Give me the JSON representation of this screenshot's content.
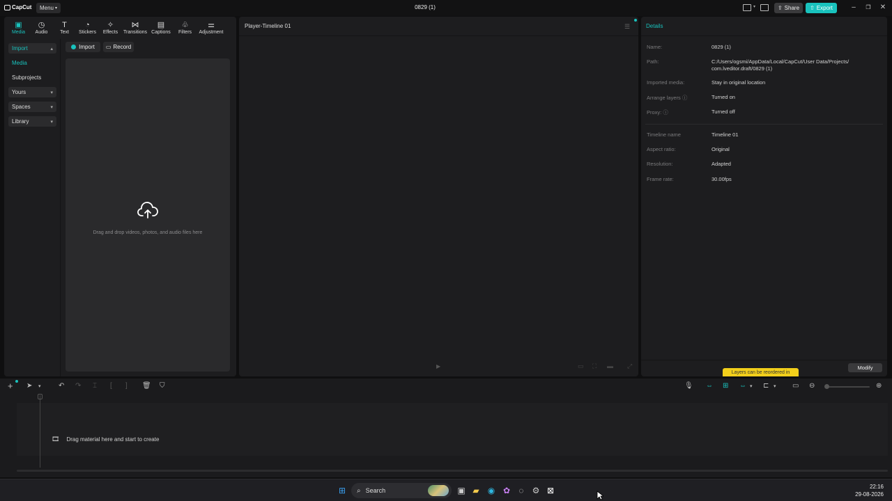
{
  "app": {
    "logo_text": "CapCut",
    "menu_label": "Menu",
    "project_title": "0829 (1)",
    "share_label": "Share",
    "export_label": "Export"
  },
  "media_tabs": [
    {
      "label": "Media",
      "icon": "media-icon"
    },
    {
      "label": "Audio",
      "icon": "audio-icon"
    },
    {
      "label": "Text",
      "icon": "text-icon"
    },
    {
      "label": "Stickers",
      "icon": "stickers-icon"
    },
    {
      "label": "Effects",
      "icon": "effects-icon"
    },
    {
      "label": "Transitions",
      "icon": "transitions-icon"
    },
    {
      "label": "Captions",
      "icon": "captions-icon"
    },
    {
      "label": "Filters",
      "icon": "filters-icon"
    },
    {
      "label": "Adjustment",
      "icon": "adjustment-icon"
    }
  ],
  "side_nav": {
    "import": "Import",
    "media": "Media",
    "subprojects": "Subprojects",
    "yours": "Yours",
    "spaces": "Spaces",
    "library": "Library"
  },
  "media_panel": {
    "import_button": "Import",
    "record_button": "Record",
    "drop_hint": "Drag and drop videos, photos, and audio files here"
  },
  "player": {
    "title": "Player-Timeline 01"
  },
  "details": {
    "title": "Details",
    "rows": [
      {
        "key": "Name:",
        "value": "0829 (1)"
      },
      {
        "key": "Path:",
        "value": "C:/Users/ogsmi/AppData/Local/CapCut/User Data/Projects/",
        "value2": "com.lveditor.draft/0829 (1)"
      },
      {
        "key": "Imported media:",
        "value": "Stay in original location"
      },
      {
        "key": "Arrange layers",
        "value": "Turned on"
      },
      {
        "key": "Proxy:",
        "value": "Turned off"
      },
      {
        "key": "Timeline name",
        "value": "Timeline 01"
      },
      {
        "key": "Aspect ratio:",
        "value": "Original"
      },
      {
        "key": "Resolution:",
        "value": "Adapted"
      },
      {
        "key": "Frame rate:",
        "value": "30.00fps"
      }
    ],
    "modify_button": "Modify",
    "tooltip": "Layers can be reordered in"
  },
  "timeline": {
    "empty_hint": "Drag material here and start to create"
  },
  "taskbar": {
    "search_label": "Search",
    "time": "22:16",
    "date": "29-08-2026"
  },
  "colors": {
    "accent": "#19c2bd",
    "tooltip": "#f2cf1b"
  }
}
